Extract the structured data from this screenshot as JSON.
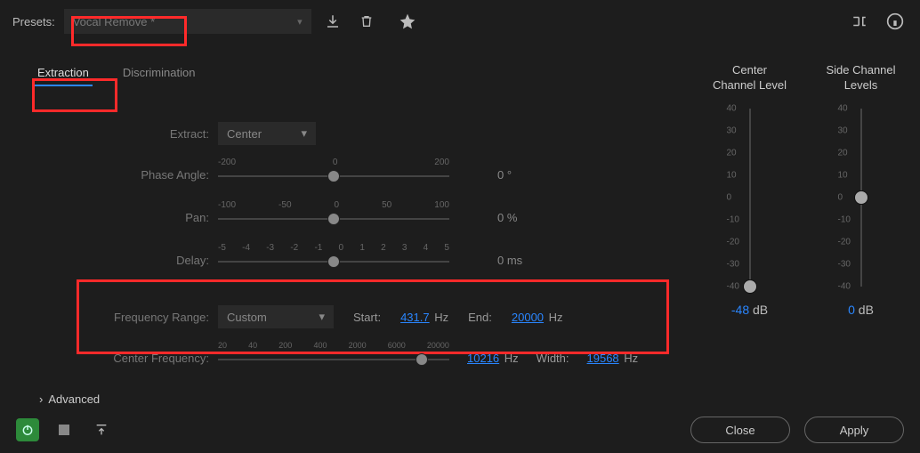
{
  "presets": {
    "label": "Presets:",
    "value": "Vocal Remove *"
  },
  "tabs": {
    "extraction": "Extraction",
    "discrimination": "Discrimination"
  },
  "extract": {
    "label": "Extract:",
    "value": "Center"
  },
  "phase": {
    "label": "Phase Angle:",
    "ticks": [
      "-200",
      "0",
      "200"
    ],
    "readout": "0 °"
  },
  "pan": {
    "label": "Pan:",
    "ticks": [
      "-100",
      "-50",
      "0",
      "50",
      "100"
    ],
    "readout": "0 %"
  },
  "delay": {
    "label": "Delay:",
    "ticks": [
      "-5",
      "-4",
      "-3",
      "-2",
      "-1",
      "0",
      "1",
      "2",
      "3",
      "4",
      "5"
    ],
    "readout": "0 ms"
  },
  "freqrange": {
    "label": "Frequency Range:",
    "value": "Custom",
    "start_label": "Start:",
    "start_value": "431.7",
    "start_unit": "Hz",
    "end_label": "End:",
    "end_value": "20000",
    "end_unit": "Hz"
  },
  "centerfreq": {
    "label": "Center Frequency:",
    "ticks": [
      "20",
      "40",
      "200",
      "400",
      "2000",
      "6000",
      "20000"
    ],
    "value": "10216",
    "unit": "Hz",
    "width_label": "Width:",
    "width_value": "19568",
    "width_unit": "Hz"
  },
  "advanced": "Advanced",
  "center_channel": {
    "title": "Center\nChannel Level",
    "value": "-48",
    "unit": "dB"
  },
  "side_channel": {
    "title": "Side Channel\nLevels",
    "value": "0",
    "unit": "dB"
  },
  "vticks": [
    "40",
    "30",
    "20",
    "10",
    "0",
    "-10",
    "-20",
    "-30",
    "-40"
  ],
  "buttons": {
    "close": "Close",
    "apply": "Apply"
  }
}
